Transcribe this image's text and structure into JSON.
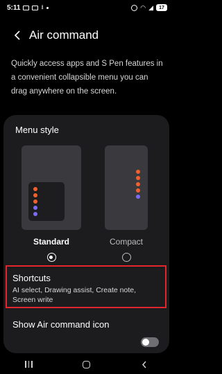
{
  "status_bar": {
    "time": "5:11",
    "battery": "17"
  },
  "header": {
    "title": "Air command",
    "back_icon": "chevron-left-icon"
  },
  "description": "Quickly access apps and S Pen features in a convenient collapsible menu you can drag anywhere on the screen.",
  "menu_style": {
    "label": "Menu style",
    "options": [
      {
        "label": "Standard",
        "selected": true
      },
      {
        "label": "Compact",
        "selected": false
      }
    ]
  },
  "shortcuts": {
    "title": "Shortcuts",
    "subtitle": "AI select, Drawing assist, Create note, Screen write"
  },
  "show_icon": {
    "label": "Show Air command icon",
    "enabled": false
  },
  "colors": {
    "accent_orange": "#f1602e",
    "accent_purple": "#7b6cf2",
    "highlight_red": "#e3262d"
  }
}
